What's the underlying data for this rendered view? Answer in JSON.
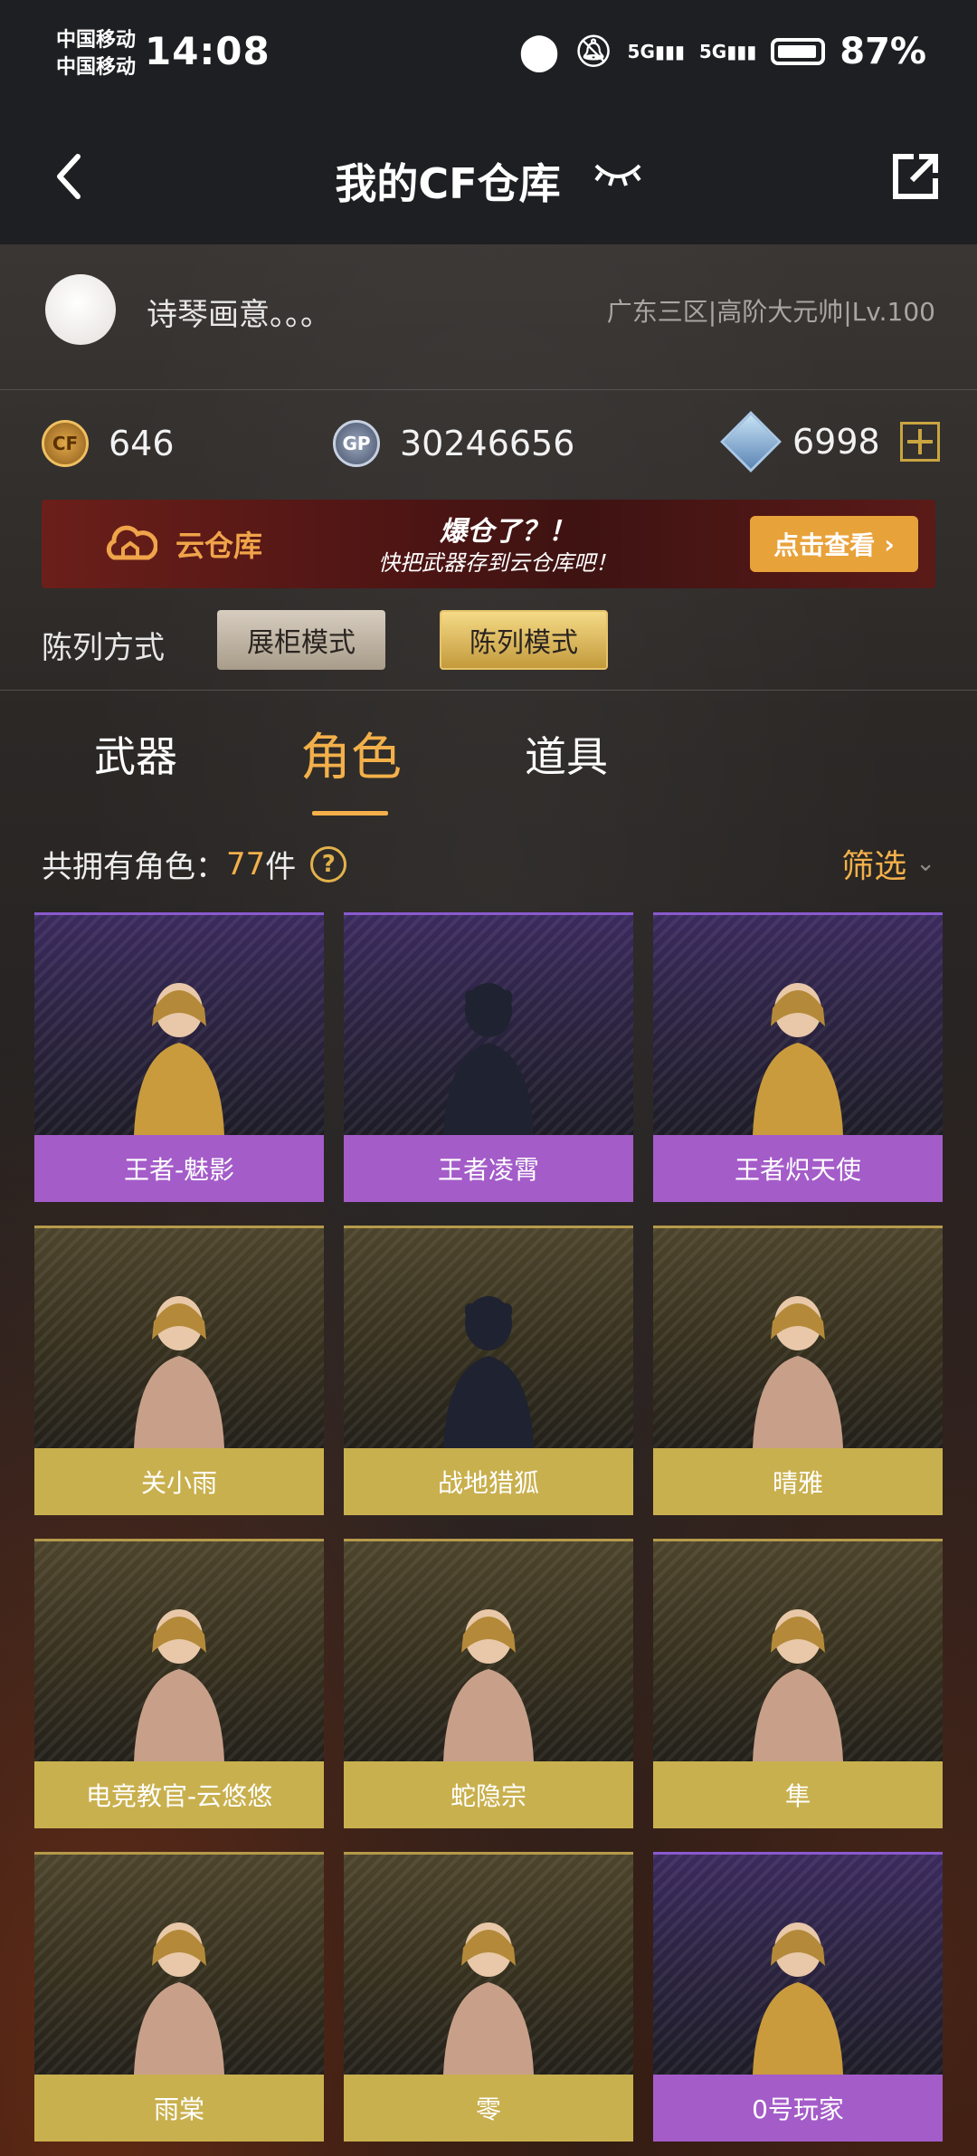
{
  "status_bar": {
    "carrier1": "中国移动",
    "carrier2": "中国移动",
    "time": "14:08",
    "battery": "87%"
  },
  "header": {
    "title": "我的CF仓库"
  },
  "profile": {
    "username": "诗琴画意。。。",
    "server": "广东三区|高阶大元帅|Lv.100"
  },
  "currency": {
    "cf": "646",
    "gp": "30246656",
    "diamond": "6998"
  },
  "banner": {
    "title": "云仓库",
    "line1": "爆仓了？！",
    "line2": "快把武器存到云仓库吧！",
    "button": "点击查看"
  },
  "display_mode": {
    "label": "陈列方式",
    "showcase": "展柜模式",
    "list": "陈列模式"
  },
  "tabs": [
    {
      "label": "武器",
      "active": false
    },
    {
      "label": "角色",
      "active": true
    },
    {
      "label": "道具",
      "active": false
    }
  ],
  "count": {
    "prefix": "共拥有角色：",
    "number": "77",
    "suffix": "件"
  },
  "filter_label": "筛选",
  "characters": [
    {
      "name": "王者-魅影",
      "rarity": "purple",
      "locked": false
    },
    {
      "name": "王者凌霄",
      "rarity": "purple",
      "locked": true
    },
    {
      "name": "王者炽天使",
      "rarity": "purple",
      "locked": false
    },
    {
      "name": "关小雨",
      "rarity": "gold",
      "locked": false
    },
    {
      "name": "战地猎狐",
      "rarity": "gold",
      "locked": true
    },
    {
      "name": "晴雅",
      "rarity": "gold",
      "locked": false
    },
    {
      "name": "电竞教官-云悠悠",
      "rarity": "gold",
      "locked": false
    },
    {
      "name": "蛇隐宗",
      "rarity": "gold",
      "locked": false
    },
    {
      "name": "隼",
      "rarity": "gold",
      "locked": false
    },
    {
      "name": "雨棠",
      "rarity": "gold",
      "locked": false
    },
    {
      "name": "零",
      "rarity": "gold",
      "locked": false
    },
    {
      "name": "0号玩家",
      "rarity": "purple",
      "locked": false
    }
  ]
}
